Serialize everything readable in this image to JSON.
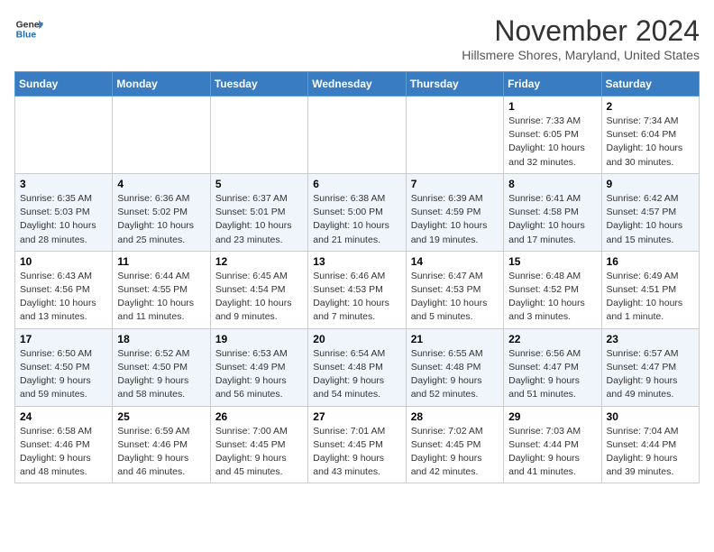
{
  "header": {
    "logo_line1": "General",
    "logo_line2": "Blue",
    "title": "November 2024",
    "location": "Hillsmere Shores, Maryland, United States"
  },
  "weekdays": [
    "Sunday",
    "Monday",
    "Tuesday",
    "Wednesday",
    "Thursday",
    "Friday",
    "Saturday"
  ],
  "weeks": [
    [
      {
        "day": "",
        "info": ""
      },
      {
        "day": "",
        "info": ""
      },
      {
        "day": "",
        "info": ""
      },
      {
        "day": "",
        "info": ""
      },
      {
        "day": "",
        "info": ""
      },
      {
        "day": "1",
        "info": "Sunrise: 7:33 AM\nSunset: 6:05 PM\nDaylight: 10 hours\nand 32 minutes."
      },
      {
        "day": "2",
        "info": "Sunrise: 7:34 AM\nSunset: 6:04 PM\nDaylight: 10 hours\nand 30 minutes."
      }
    ],
    [
      {
        "day": "3",
        "info": "Sunrise: 6:35 AM\nSunset: 5:03 PM\nDaylight: 10 hours\nand 28 minutes."
      },
      {
        "day": "4",
        "info": "Sunrise: 6:36 AM\nSunset: 5:02 PM\nDaylight: 10 hours\nand 25 minutes."
      },
      {
        "day": "5",
        "info": "Sunrise: 6:37 AM\nSunset: 5:01 PM\nDaylight: 10 hours\nand 23 minutes."
      },
      {
        "day": "6",
        "info": "Sunrise: 6:38 AM\nSunset: 5:00 PM\nDaylight: 10 hours\nand 21 minutes."
      },
      {
        "day": "7",
        "info": "Sunrise: 6:39 AM\nSunset: 4:59 PM\nDaylight: 10 hours\nand 19 minutes."
      },
      {
        "day": "8",
        "info": "Sunrise: 6:41 AM\nSunset: 4:58 PM\nDaylight: 10 hours\nand 17 minutes."
      },
      {
        "day": "9",
        "info": "Sunrise: 6:42 AM\nSunset: 4:57 PM\nDaylight: 10 hours\nand 15 minutes."
      }
    ],
    [
      {
        "day": "10",
        "info": "Sunrise: 6:43 AM\nSunset: 4:56 PM\nDaylight: 10 hours\nand 13 minutes."
      },
      {
        "day": "11",
        "info": "Sunrise: 6:44 AM\nSunset: 4:55 PM\nDaylight: 10 hours\nand 11 minutes."
      },
      {
        "day": "12",
        "info": "Sunrise: 6:45 AM\nSunset: 4:54 PM\nDaylight: 10 hours\nand 9 minutes."
      },
      {
        "day": "13",
        "info": "Sunrise: 6:46 AM\nSunset: 4:53 PM\nDaylight: 10 hours\nand 7 minutes."
      },
      {
        "day": "14",
        "info": "Sunrise: 6:47 AM\nSunset: 4:53 PM\nDaylight: 10 hours\nand 5 minutes."
      },
      {
        "day": "15",
        "info": "Sunrise: 6:48 AM\nSunset: 4:52 PM\nDaylight: 10 hours\nand 3 minutes."
      },
      {
        "day": "16",
        "info": "Sunrise: 6:49 AM\nSunset: 4:51 PM\nDaylight: 10 hours\nand 1 minute."
      }
    ],
    [
      {
        "day": "17",
        "info": "Sunrise: 6:50 AM\nSunset: 4:50 PM\nDaylight: 9 hours\nand 59 minutes."
      },
      {
        "day": "18",
        "info": "Sunrise: 6:52 AM\nSunset: 4:50 PM\nDaylight: 9 hours\nand 58 minutes."
      },
      {
        "day": "19",
        "info": "Sunrise: 6:53 AM\nSunset: 4:49 PM\nDaylight: 9 hours\nand 56 minutes."
      },
      {
        "day": "20",
        "info": "Sunrise: 6:54 AM\nSunset: 4:48 PM\nDaylight: 9 hours\nand 54 minutes."
      },
      {
        "day": "21",
        "info": "Sunrise: 6:55 AM\nSunset: 4:48 PM\nDaylight: 9 hours\nand 52 minutes."
      },
      {
        "day": "22",
        "info": "Sunrise: 6:56 AM\nSunset: 4:47 PM\nDaylight: 9 hours\nand 51 minutes."
      },
      {
        "day": "23",
        "info": "Sunrise: 6:57 AM\nSunset: 4:47 PM\nDaylight: 9 hours\nand 49 minutes."
      }
    ],
    [
      {
        "day": "24",
        "info": "Sunrise: 6:58 AM\nSunset: 4:46 PM\nDaylight: 9 hours\nand 48 minutes."
      },
      {
        "day": "25",
        "info": "Sunrise: 6:59 AM\nSunset: 4:46 PM\nDaylight: 9 hours\nand 46 minutes."
      },
      {
        "day": "26",
        "info": "Sunrise: 7:00 AM\nSunset: 4:45 PM\nDaylight: 9 hours\nand 45 minutes."
      },
      {
        "day": "27",
        "info": "Sunrise: 7:01 AM\nSunset: 4:45 PM\nDaylight: 9 hours\nand 43 minutes."
      },
      {
        "day": "28",
        "info": "Sunrise: 7:02 AM\nSunset: 4:45 PM\nDaylight: 9 hours\nand 42 minutes."
      },
      {
        "day": "29",
        "info": "Sunrise: 7:03 AM\nSunset: 4:44 PM\nDaylight: 9 hours\nand 41 minutes."
      },
      {
        "day": "30",
        "info": "Sunrise: 7:04 AM\nSunset: 4:44 PM\nDaylight: 9 hours\nand 39 minutes."
      }
    ]
  ]
}
